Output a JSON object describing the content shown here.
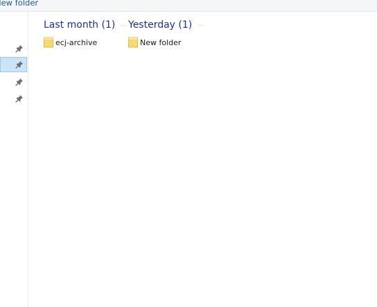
{
  "breadcrumb": {
    "current": "New folder"
  },
  "nav_pane": {
    "pinned_items": [
      {
        "pinned": true,
        "selected": false
      },
      {
        "pinned": true,
        "selected": true
      },
      {
        "pinned": true,
        "selected": false
      },
      {
        "pinned": true,
        "selected": false
      }
    ],
    "pin_icon": "pin-icon"
  },
  "groups": [
    {
      "title": "Last month (1)",
      "items": [
        {
          "name": "ecj-archive",
          "icon": "folder-icon"
        }
      ]
    },
    {
      "title": "Yesterday (1)",
      "items": [
        {
          "name": "New folder",
          "icon": "folder-icon"
        }
      ]
    }
  ],
  "colors": {
    "group_title": "#1e3287",
    "selection_bg": "#cce4f7",
    "selection_border": "#99c9ef",
    "folder": "#f8d775"
  }
}
